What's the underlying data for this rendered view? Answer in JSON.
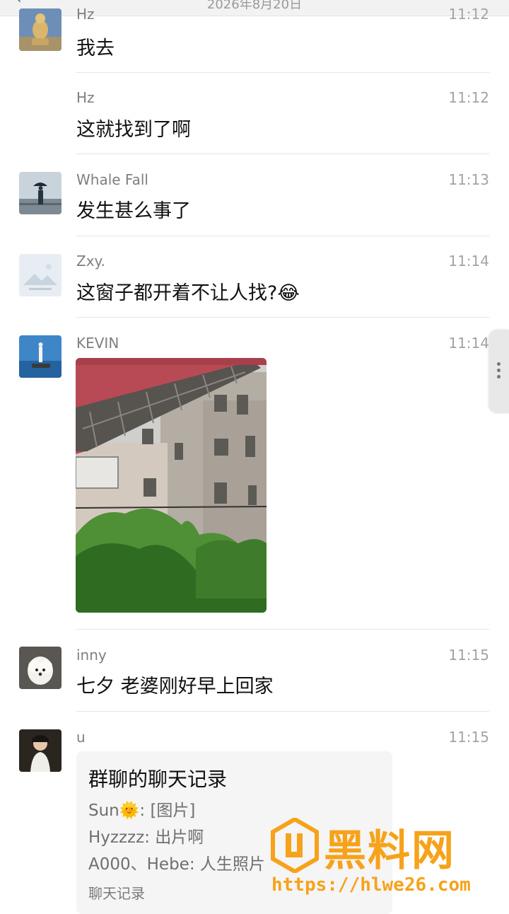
{
  "header": {
    "date": "2026年8月20日",
    "back_icon": "chevron-left-icon"
  },
  "messages": [
    {
      "name": "Hz",
      "time": "11:12",
      "text": "我去"
    },
    {
      "name": "Hz",
      "time": "11:12",
      "text": "这就找到了啊"
    },
    {
      "name": "Whale Fall",
      "time": "11:13",
      "text": "发生甚么事了"
    },
    {
      "name": "Zxy.",
      "time": "11:14",
      "text": "这窗子都开着不让人找?",
      "emoji": "😂"
    },
    {
      "name": "KEVIN",
      "time": "11:14",
      "image": "building-window-photo"
    },
    {
      "name": "inny",
      "time": "11:15",
      "text": "七夕 老婆刚好早上回家"
    },
    {
      "name": "u",
      "time": "11:15"
    }
  ],
  "card": {
    "title": "群聊的聊天记录",
    "lines": [
      "Sun🌞: [图片]",
      "Hyzzzz: 出片啊",
      "A000、Hebe: 人生照片"
    ],
    "footer": "聊天记录"
  },
  "watermark": {
    "title": "黑料网",
    "url": "https://hlwe26.com"
  },
  "colors": {
    "watermark": "#f6a21a",
    "separator": "#e5e5e5",
    "card_bg": "#f5f5f5"
  }
}
